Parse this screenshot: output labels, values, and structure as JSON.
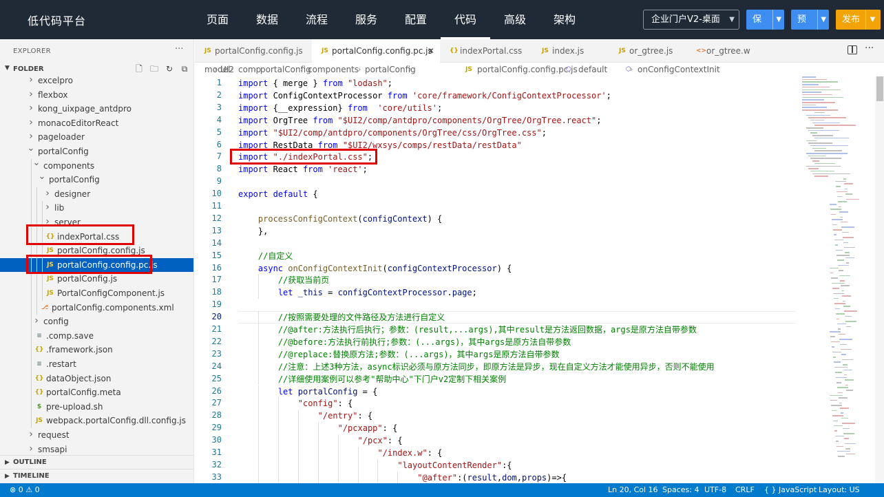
{
  "topbar": {
    "brand": "低代码平台",
    "nav": [
      "页面",
      "数据",
      "流程",
      "服务",
      "配置",
      "代码",
      "高级",
      "架构"
    ],
    "active_nav": "代码",
    "select_value": "企业门户V2-桌面",
    "save_label": "保存",
    "preview_label": "预览",
    "publish_label": "发布"
  },
  "sidebar": {
    "title": "EXPLORER",
    "more": "···",
    "folder": "FOLDER",
    "outline": "OUTLINE",
    "timeline": "TIMELINE",
    "tree": [
      {
        "name": "excelpro",
        "type": "folder",
        "depth": 0,
        "open": false
      },
      {
        "name": "flexbox",
        "type": "folder",
        "depth": 0,
        "open": false
      },
      {
        "name": "kong_uixpage_antdpro",
        "type": "folder",
        "depth": 0,
        "open": false
      },
      {
        "name": "monacoEditorReact",
        "type": "folder",
        "depth": 0,
        "open": false
      },
      {
        "name": "pageloader",
        "type": "folder",
        "depth": 0,
        "open": false
      },
      {
        "name": "portalConfig",
        "type": "folder",
        "depth": 0,
        "open": true
      },
      {
        "name": "components",
        "type": "folder",
        "depth": 1,
        "open": true
      },
      {
        "name": "portalConfig",
        "type": "folder",
        "depth": 2,
        "open": true
      },
      {
        "name": "designer",
        "type": "folder",
        "depth": 3,
        "open": false
      },
      {
        "name": "lib",
        "type": "folder",
        "depth": 3,
        "open": false
      },
      {
        "name": "server",
        "type": "folder",
        "depth": 3,
        "open": false
      },
      {
        "name": "indexPortal.css",
        "type": "css",
        "depth": 3
      },
      {
        "name": "portalConfig.config.js",
        "type": "js",
        "depth": 3
      },
      {
        "name": "portalConfig.config.pc.js",
        "type": "js",
        "depth": 3,
        "selected": true
      },
      {
        "name": "portalConfig.js",
        "type": "js",
        "depth": 3
      },
      {
        "name": "PortalConfigComponent.js",
        "type": "js",
        "depth": 3
      },
      {
        "name": "portalConfig.components.xml",
        "type": "xml",
        "depth": 2
      },
      {
        "name": "config",
        "type": "folder",
        "depth": 1,
        "open": false
      },
      {
        "name": ".comp.save",
        "type": "file",
        "depth": 1
      },
      {
        "name": ".framework.json",
        "type": "json",
        "depth": 1
      },
      {
        "name": ".restart",
        "type": "file",
        "depth": 1
      },
      {
        "name": "dataObject.json",
        "type": "json",
        "depth": 1
      },
      {
        "name": "portalConfig.meta",
        "type": "json",
        "depth": 1
      },
      {
        "name": "pre-upload.sh",
        "type": "sh",
        "depth": 1
      },
      {
        "name": "webpack.portalConfig.dll.config.js",
        "type": "js",
        "depth": 1
      },
      {
        "name": "request",
        "type": "folder",
        "depth": 0,
        "open": false
      },
      {
        "name": "smsapi",
        "type": "folder",
        "depth": 0,
        "open": false
      }
    ]
  },
  "tabs": [
    {
      "icon": "JS",
      "name": "portalConfig.config.js",
      "active": false
    },
    {
      "icon": "JS",
      "name": "portalConfig.config.pc.js",
      "active": true,
      "close": "✕"
    },
    {
      "icon": "{}",
      "name": "indexPortal.css",
      "active": false
    },
    {
      "icon": "JS",
      "name": "index.js",
      "active": false
    },
    {
      "icon": "JS",
      "name": "or_gtree.js",
      "active": false
    },
    {
      "icon": "<>",
      "name": "or_gtree.w",
      "active": false
    }
  ],
  "breadcrumb": [
    "model",
    "UI2",
    "comp",
    "portalConfig",
    "components",
    "portalConfig",
    "portalConfig.config.pc.js",
    "default",
    "onConfigContextInit"
  ],
  "editor": {
    "current_line": 20,
    "lines": [
      {
        "n": 1,
        "indent": 0,
        "tokens": [
          [
            "k",
            "import"
          ],
          [
            "p",
            " { merge } "
          ],
          [
            "k",
            "from"
          ],
          [
            "p",
            " "
          ],
          [
            "s",
            "\"lodash\""
          ],
          [
            "p",
            ";"
          ]
        ]
      },
      {
        "n": 2,
        "indent": 0,
        "tokens": [
          [
            "k",
            "import"
          ],
          [
            "p",
            " ConfigContextProcessor "
          ],
          [
            "k",
            "from"
          ],
          [
            "p",
            " "
          ],
          [
            "s",
            "'core/framework/ConfigContextProcessor'"
          ],
          [
            "p",
            ";"
          ]
        ]
      },
      {
        "n": 3,
        "indent": 0,
        "tokens": [
          [
            "k",
            "import"
          ],
          [
            "p",
            " {__expression} "
          ],
          [
            "k",
            "from"
          ],
          [
            "p",
            "  "
          ],
          [
            "s",
            "'core/utils'"
          ],
          [
            "p",
            ";"
          ]
        ]
      },
      {
        "n": 4,
        "indent": 0,
        "tokens": [
          [
            "k",
            "import"
          ],
          [
            "p",
            " OrgTree "
          ],
          [
            "k",
            "from"
          ],
          [
            "p",
            " "
          ],
          [
            "s",
            "\"$UI2/comp/antdpro/components/OrgTree/OrgTree.react\""
          ],
          [
            "p",
            ";"
          ]
        ]
      },
      {
        "n": 5,
        "indent": 0,
        "tokens": [
          [
            "k",
            "import"
          ],
          [
            "p",
            " "
          ],
          [
            "s",
            "\"$UI2/comp/antdpro/components/OrgTree/css/OrgTree.css\""
          ],
          [
            "p",
            ";"
          ]
        ]
      },
      {
        "n": 6,
        "indent": 0,
        "tokens": [
          [
            "k",
            "import"
          ],
          [
            "p",
            " RestData "
          ],
          [
            "k",
            "from"
          ],
          [
            "p",
            " "
          ],
          [
            "s",
            "\"$UI2/wxsys/comps/restData/restData\""
          ]
        ]
      },
      {
        "n": 7,
        "indent": 0,
        "tokens": [
          [
            "k",
            "import"
          ],
          [
            "p",
            " "
          ],
          [
            "s",
            "\"./indexPortal.css\""
          ],
          [
            "p",
            ";"
          ]
        ]
      },
      {
        "n": 8,
        "indent": 0,
        "tokens": [
          [
            "k",
            "import"
          ],
          [
            "p",
            " React "
          ],
          [
            "k",
            "from"
          ],
          [
            "p",
            " "
          ],
          [
            "s",
            "'react'"
          ],
          [
            "p",
            ";"
          ]
        ]
      },
      {
        "n": 9,
        "indent": 0,
        "tokens": []
      },
      {
        "n": 10,
        "indent": 0,
        "tokens": [
          [
            "k",
            "export"
          ],
          [
            "p",
            " "
          ],
          [
            "k",
            "default"
          ],
          [
            "p",
            " {"
          ]
        ]
      },
      {
        "n": 11,
        "indent": 0,
        "tokens": []
      },
      {
        "n": 12,
        "indent": 1,
        "tokens": [
          [
            "f",
            "processConfigContext"
          ],
          [
            "p",
            "("
          ],
          [
            "v",
            "configContext"
          ],
          [
            "p",
            ") {"
          ]
        ]
      },
      {
        "n": 13,
        "indent": 1,
        "tokens": [
          [
            "p",
            "},"
          ]
        ]
      },
      {
        "n": 14,
        "indent": 0,
        "tokens": []
      },
      {
        "n": 15,
        "indent": 1,
        "tokens": [
          [
            "c",
            "//自定义"
          ]
        ]
      },
      {
        "n": 16,
        "indent": 1,
        "tokens": [
          [
            "k",
            "async"
          ],
          [
            "p",
            " "
          ],
          [
            "f",
            "onConfigContextInit"
          ],
          [
            "p",
            "("
          ],
          [
            "v",
            "configContextProcessor"
          ],
          [
            "p",
            ") {"
          ]
        ]
      },
      {
        "n": 17,
        "indent": 2,
        "tokens": [
          [
            "c",
            "//获取当前页"
          ]
        ]
      },
      {
        "n": 18,
        "indent": 2,
        "tokens": [
          [
            "k",
            "let"
          ],
          [
            "p",
            " "
          ],
          [
            "v",
            "_this"
          ],
          [
            "p",
            " = "
          ],
          [
            "v",
            "configContextProcessor"
          ],
          [
            "p",
            "."
          ],
          [
            "v",
            "page"
          ],
          [
            "p",
            ";"
          ]
        ]
      },
      {
        "n": 19,
        "indent": 0,
        "tokens": []
      },
      {
        "n": 20,
        "indent": 2,
        "tokens": [
          [
            "c",
            "//按照需要处理的文件路径及方法进行自定义"
          ]
        ]
      },
      {
        "n": 21,
        "indent": 2,
        "tokens": [
          [
            "c",
            "//@after:方法执行后执行；参数：(result,...args),其中result是方法返回数据，args是原方法自带参数"
          ]
        ]
      },
      {
        "n": 22,
        "indent": 2,
        "tokens": [
          [
            "c",
            "//@before:方法执行前执行;参数：(...args)，其中args是原方法自带参数"
          ]
        ]
      },
      {
        "n": 23,
        "indent": 2,
        "tokens": [
          [
            "c",
            "//@replace:替换原方法;参数：(...args)，其中args是原方法自带参数"
          ]
        ]
      },
      {
        "n": 24,
        "indent": 2,
        "tokens": [
          [
            "c",
            "//注意：上述3种方法，async标识必须与原方法同步，即原方法是异步，现在自定义方法才能使用异步，否则不能使用"
          ]
        ]
      },
      {
        "n": 25,
        "indent": 2,
        "tokens": [
          [
            "c",
            "//详细使用案例可以参考\"帮助中心\"下门户v2定制下相关案例"
          ]
        ]
      },
      {
        "n": 26,
        "indent": 2,
        "tokens": [
          [
            "k",
            "let"
          ],
          [
            "p",
            " "
          ],
          [
            "v",
            "portalConfig"
          ],
          [
            "p",
            " = {"
          ]
        ]
      },
      {
        "n": 27,
        "indent": 3,
        "tokens": [
          [
            "s",
            "\"config\""
          ],
          [
            "p",
            ": {"
          ]
        ]
      },
      {
        "n": 28,
        "indent": 4,
        "tokens": [
          [
            "s",
            "\"/entry\""
          ],
          [
            "p",
            ": {"
          ]
        ]
      },
      {
        "n": 29,
        "indent": 5,
        "tokens": [
          [
            "s",
            "\"/pcxapp\""
          ],
          [
            "p",
            ": {"
          ]
        ]
      },
      {
        "n": 30,
        "indent": 6,
        "tokens": [
          [
            "s",
            "\"/pcx\""
          ],
          [
            "p",
            ": {"
          ]
        ]
      },
      {
        "n": 31,
        "indent": 7,
        "tokens": [
          [
            "s",
            "\"/index.w\""
          ],
          [
            "p",
            ": {"
          ]
        ]
      },
      {
        "n": 32,
        "indent": 8,
        "tokens": [
          [
            "s",
            "\"layoutContentRender\""
          ],
          [
            "p",
            ":{"
          ]
        ]
      },
      {
        "n": 33,
        "indent": 9,
        "tokens": [
          [
            "s",
            "\"@after\""
          ],
          [
            "p",
            ":("
          ],
          [
            "v",
            "result"
          ],
          [
            "p",
            ","
          ],
          [
            "v",
            "dom"
          ],
          [
            "p",
            ","
          ],
          [
            "v",
            "props"
          ],
          [
            "p",
            ")=>{"
          ]
        ]
      }
    ]
  },
  "statusbar": {
    "problems": "⊗ 0 ⚠ 0",
    "position": "Ln 20, Col 16",
    "spaces": "Spaces: 4",
    "encoding": "UTF-8",
    "eol": "CRLF",
    "language": "{ } JavaScript",
    "layout": "Layout: US"
  },
  "colors": {
    "topbar_bg": "#1f2a36",
    "accent_blue": "#3d8ef0",
    "publish_orange": "#f2a308",
    "selection_blue": "#0060c0",
    "statusbar_blue": "#007acc",
    "annotation_red": "#e00000"
  }
}
